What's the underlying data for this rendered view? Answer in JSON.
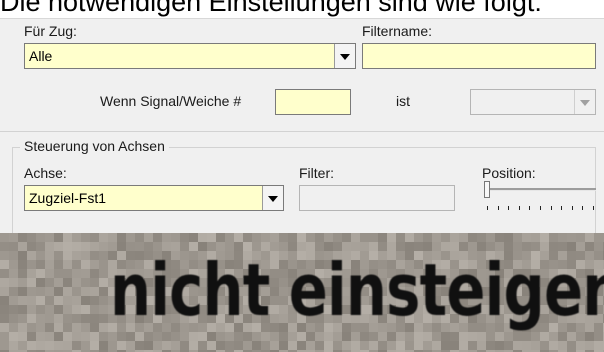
{
  "caption": "Die notwendigen Einstellungen sind wie folgt:",
  "train_filter": {
    "label": "Für Zug:",
    "value": "Alle"
  },
  "filter_name": {
    "label": "Filtername:",
    "value": ""
  },
  "signal_condition": {
    "prefix": "Wenn Signal/Weiche #",
    "value": "",
    "suffix": "ist",
    "state_value": ""
  },
  "axis_control": {
    "group_title": "Steuerung von Achsen",
    "axis_label": "Achse:",
    "axis_value": "Zugziel-Fst1",
    "filter_label": "Filter:",
    "filter_value": "",
    "position_label": "Position:",
    "position_fraction": 0
  },
  "display_sign": {
    "text": "nicht einsteigen"
  },
  "colors": {
    "input_highlight": "#ffffcc",
    "dialog_background": "#f0f0f0",
    "sign_background": "#9c938a",
    "sign_text": "#101010"
  }
}
